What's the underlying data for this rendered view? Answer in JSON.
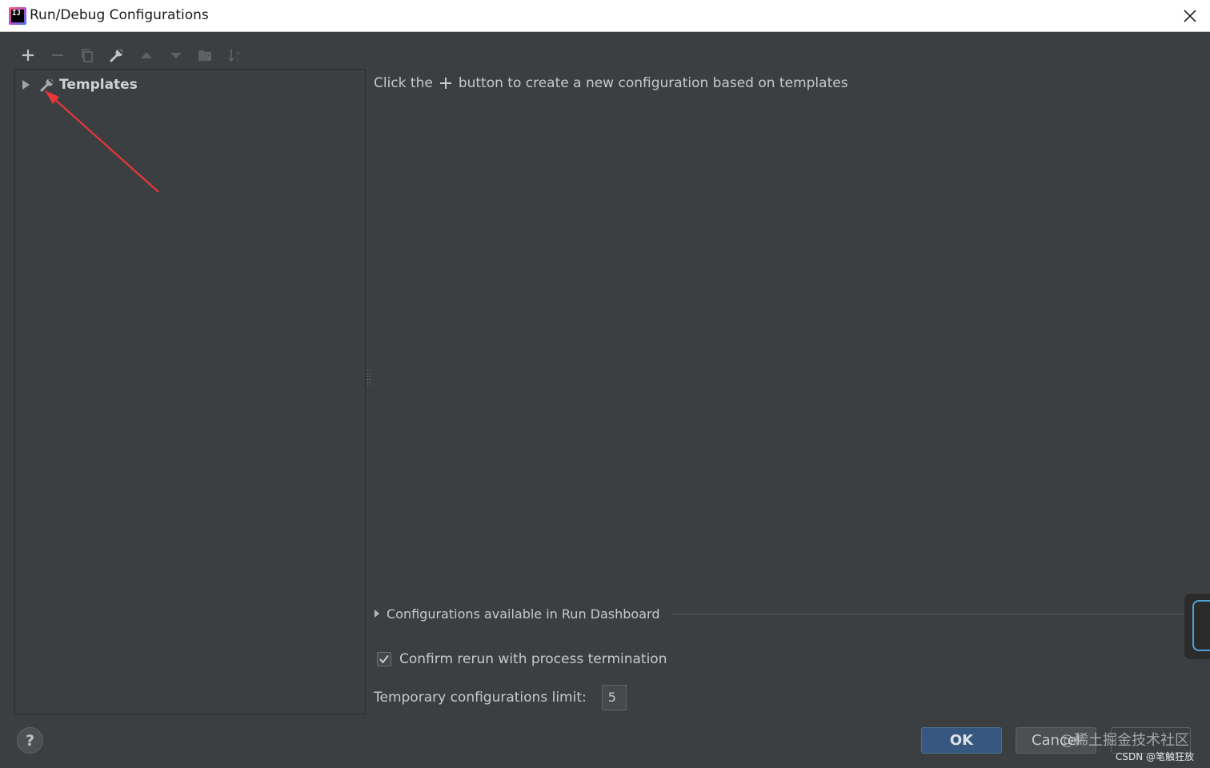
{
  "window": {
    "title": "Run/Debug Configurations",
    "app_icon_text": "IJ"
  },
  "toolbar": {
    "buttons": [
      {
        "icon": "plus-icon",
        "enabled": true
      },
      {
        "icon": "minus-icon",
        "enabled": false
      },
      {
        "icon": "copy-icon",
        "enabled": false
      },
      {
        "icon": "wrench-icon",
        "enabled": true
      },
      {
        "icon": "arrow-up-icon",
        "enabled": false
      },
      {
        "icon": "arrow-down-icon",
        "enabled": false
      },
      {
        "icon": "new-folder-icon",
        "enabled": false
      },
      {
        "icon": "sort-icon",
        "enabled": false
      }
    ]
  },
  "tree": {
    "items": [
      {
        "label": "Templates",
        "icon": "wrench-icon",
        "expanded": false
      }
    ]
  },
  "main": {
    "hint_before": "Click the",
    "hint_after": "button to create a new configuration based on templates",
    "dashboard_label": "Configurations available in Run Dashboard",
    "confirm_label": "Confirm rerun with process termination",
    "confirm_checked": true,
    "limit_label": "Temporary configurations limit:",
    "limit_value": "5"
  },
  "footer": {
    "help_label": "?",
    "ok_label": "OK",
    "cancel_label": "Cancel"
  },
  "watermarks": {
    "line1": "@稀土掘金技术社区",
    "line2": "CSDN @笔触狂放"
  },
  "colors": {
    "background": "#3c3f41",
    "ok_button": "#365880",
    "annotation_arrow": "#e8363a"
  }
}
